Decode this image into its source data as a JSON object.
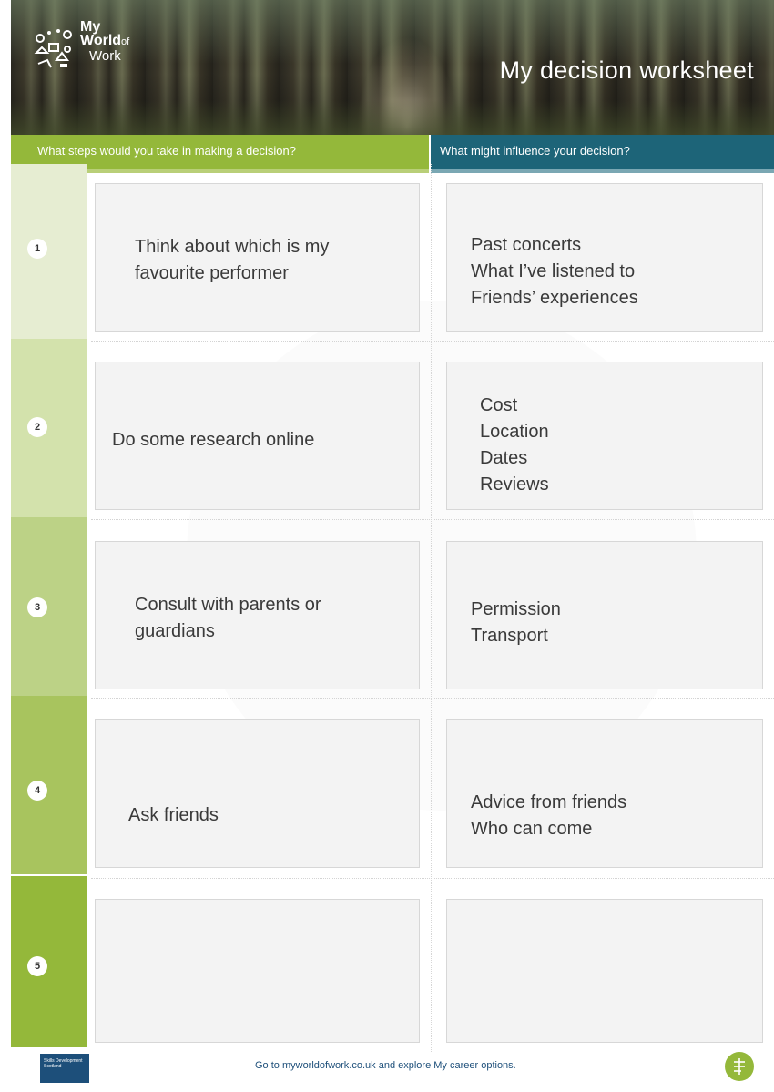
{
  "header": {
    "logo": {
      "line1": "My",
      "line2": "World",
      "line2_small": "of",
      "line3": "Work"
    },
    "title": "My decision worksheet"
  },
  "columns": {
    "left_header": "What steps would you take in making a decision?",
    "right_header": "What might influence your decision?"
  },
  "rows": [
    {
      "number": "1",
      "step": "Think about which is my\nfavourite performer",
      "influence": "Past concerts\nWhat I’ve listened to\nFriends’ experiences"
    },
    {
      "number": "2",
      "step": "Do some research online",
      "influence": "Cost\nLocation\nDates\nReviews"
    },
    {
      "number": "3",
      "step": "Consult with parents or\nguardians",
      "influence": "Permission\nTransport"
    },
    {
      "number": "4",
      "step": "Ask friends",
      "influence": "Advice from friends\nWho can come"
    },
    {
      "number": "5",
      "step": "",
      "influence": ""
    }
  ],
  "colors": {
    "left_header": "#94b83a",
    "right_header": "#1d6478",
    "row_shades": [
      "#e6edd2",
      "#d3e2ac",
      "#bcd286",
      "#a8c45e",
      "#94b83a"
    ]
  },
  "footer": {
    "logo_text": "Skills Development Scotland",
    "text": "Go to myworldofwork.co.uk and explore My career options."
  }
}
